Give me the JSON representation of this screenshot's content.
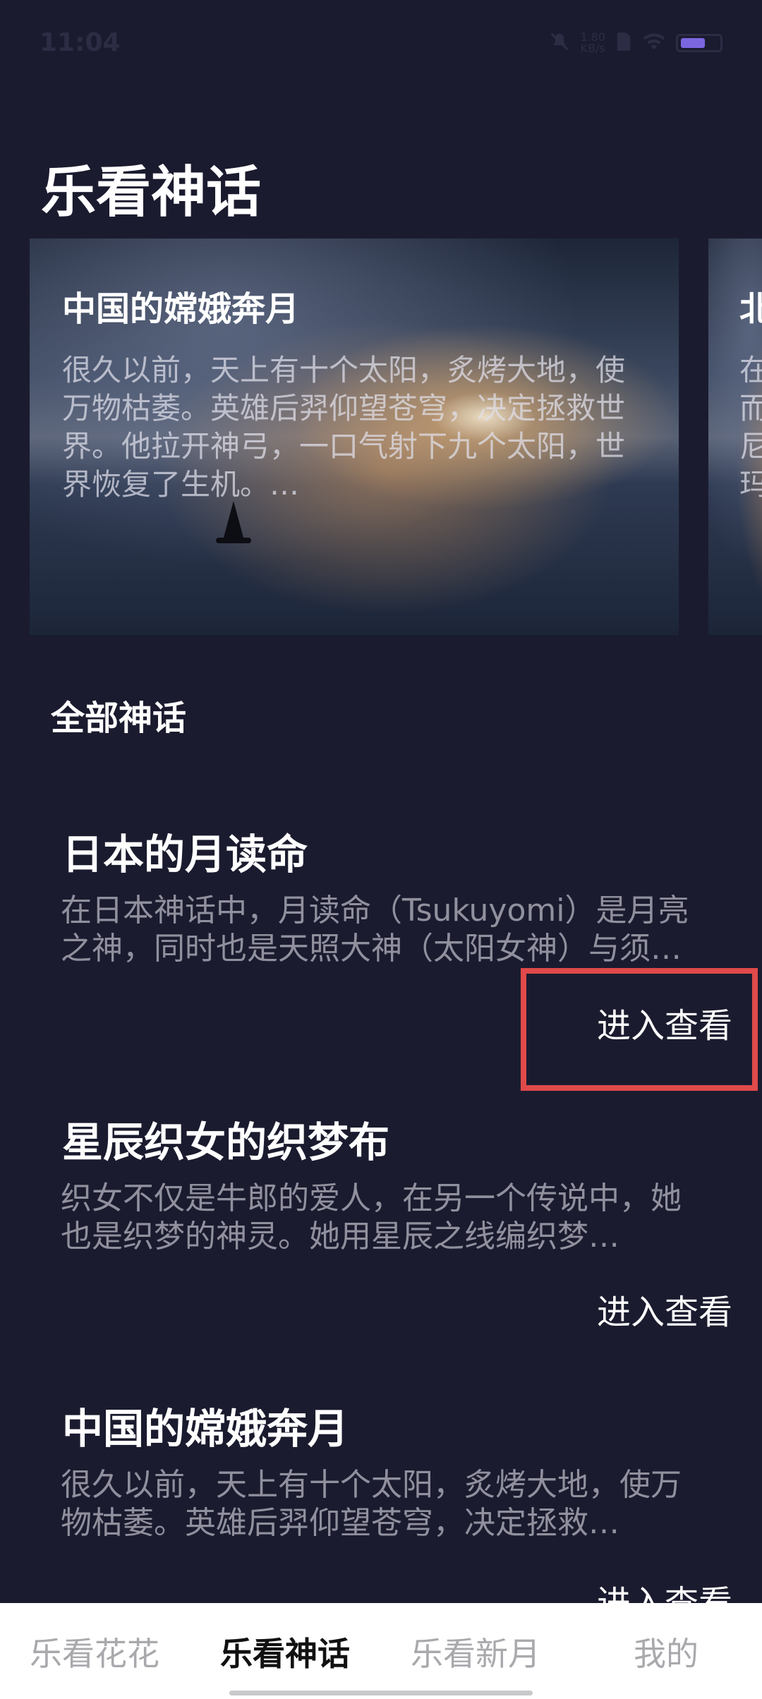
{
  "status_bar": {
    "time": "11:04",
    "net_speed": "1.80",
    "net_unit": "KB/s",
    "icons": [
      "mute-icon",
      "sim-icon",
      "wifi-icon",
      "battery-icon"
    ]
  },
  "page": {
    "title": "乐看神话"
  },
  "carousel": {
    "cards": [
      {
        "title": "中国的嫦娥奔月",
        "description": "很久以前，天上有十个太阳，炙烤大地，使万物枯萎。英雄后羿仰望苍穹，决定拯救世界。他拉开神弓，一口气射下九个太阳，世界恢复了生机。…"
      },
      {
        "title": "北",
        "description": "在而尼玛"
      }
    ]
  },
  "section": {
    "title": "全部神话"
  },
  "myths": [
    {
      "title": "日本的月读命",
      "description": "在日本神话中，月读命（Tsukuyomi）是月亮之神，同时也是天照大神（太阳女神）与须…",
      "action": "进入查看"
    },
    {
      "title": "星辰织女的织梦布",
      "description": "织女不仅是牛郎的爱人，在另一个传说中，她也是织梦的神灵。她用星辰之线编织梦…",
      "action": "进入查看"
    },
    {
      "title": "中国的嫦娥奔月",
      "description": "很久以前，天上有十个太阳，炙烤大地，使万物枯萎。英雄后羿仰望苍穹，决定拯救…",
      "action": "进入查看"
    }
  ],
  "tab_bar": {
    "tabs": [
      {
        "label": "乐看花花"
      },
      {
        "label": "乐看神话"
      },
      {
        "label": "乐看新月"
      },
      {
        "label": "我的"
      }
    ],
    "active": "乐看神话"
  },
  "colors": {
    "background": "#1b1b2f",
    "highlight": "#e04a4a",
    "tab_active": "#111111",
    "tab_inactive": "#a9a9ad"
  }
}
